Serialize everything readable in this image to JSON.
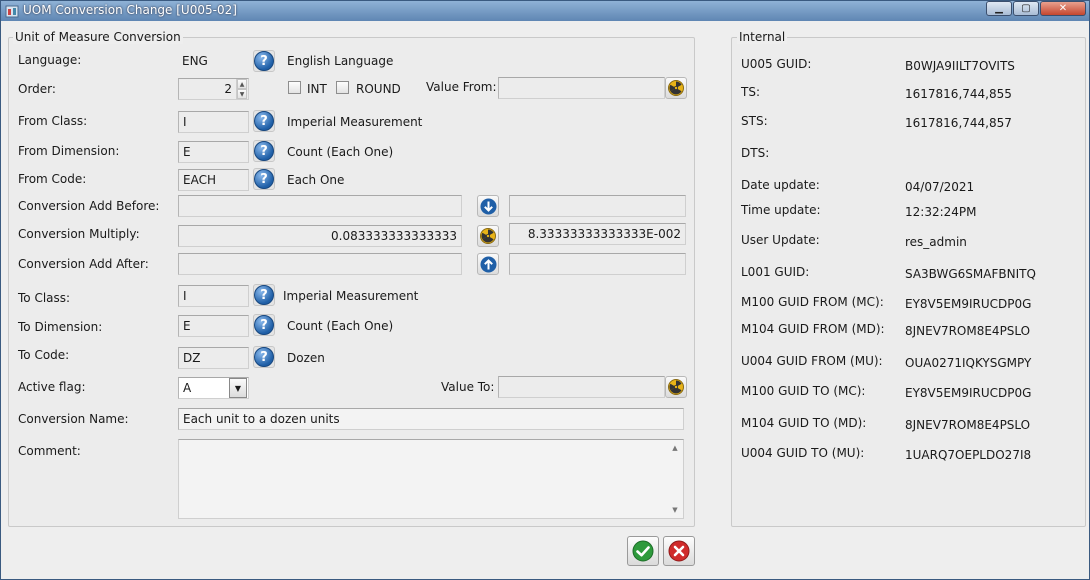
{
  "window": {
    "title": "UOM Conversion Change [U005-02]"
  },
  "left": {
    "section_title": "Unit of Measure Conversion",
    "language": {
      "label": "Language:",
      "value": "ENG",
      "desc": "English Language"
    },
    "order": {
      "label": "Order:",
      "value": "2",
      "int_label": "INT",
      "round_label": "ROUND",
      "value_from_label": "Value From:",
      "value_from": ""
    },
    "from_class": {
      "label": "From Class:",
      "value": "I",
      "desc": "Imperial Measurement"
    },
    "from_dimension": {
      "label": "From Dimension:",
      "value": "E",
      "desc": "Count (Each One)"
    },
    "from_code": {
      "label": "From Code:",
      "value": "EACH",
      "desc": "Each One"
    },
    "add_before": {
      "label": "Conversion Add Before:",
      "value": "",
      "value2": ""
    },
    "multiply": {
      "label": "Conversion Multiply:",
      "value": "0.083333333333333",
      "value2": "8.33333333333333E-002"
    },
    "add_after": {
      "label": "Conversion Add After:",
      "value": "",
      "value2": ""
    },
    "to_class": {
      "label": "To Class:",
      "value": "I",
      "desc": "Imperial Measurement"
    },
    "to_dimension": {
      "label": "To Dimension:",
      "value": "E",
      "desc": "Count (Each One)"
    },
    "to_code": {
      "label": "To Code:",
      "value": "DZ",
      "desc": "Dozen"
    },
    "active_flag": {
      "label": "Active flag:",
      "value": "A",
      "value_to_label": "Value To:",
      "value_to": ""
    },
    "conversion_name": {
      "label": "Conversion Name:",
      "value": "Each unit to a dozen units"
    },
    "comment": {
      "label": "Comment:",
      "value": ""
    }
  },
  "internal": {
    "section_title": "Internal",
    "rows": [
      {
        "label": "U005 GUID:",
        "value": "B0WJA9IILT7OVITS"
      },
      {
        "label": "TS:",
        "value": "1617816,744,855"
      },
      {
        "label": "STS:",
        "value": "1617816,744,857"
      },
      {
        "label": "DTS:",
        "value": ""
      },
      {
        "label": "Date update:",
        "value": "04/07/2021"
      },
      {
        "label": "Time update:",
        "value": "12:32:24PM"
      },
      {
        "label": "User Update:",
        "value": "res_admin"
      },
      {
        "label": "L001 GUID:",
        "value": "SA3BWG6SMAFBNITQ"
      },
      {
        "label": "M100 GUID FROM (MC):",
        "value": "EY8V5EM9IRUCDP0G"
      },
      {
        "label": "M104 GUID FROM (MD):",
        "value": "8JNEV7ROM8E4PSLO"
      },
      {
        "label": "U004 GUID FROM (MU):",
        "value": "OUA0271IQKYSGMPY"
      },
      {
        "label": "M100 GUID TO (MC):",
        "value": "EY8V5EM9IRUCDP0G"
      },
      {
        "label": "M104 GUID TO (MD):",
        "value": "8JNEV7ROM8E4PSLO"
      },
      {
        "label": "U004 GUID TO (MU):",
        "value": "1UARQ7OEPLDO27I8"
      }
    ]
  },
  "icons": {
    "help": "question-mark-icon",
    "radiation": "radiation-icon",
    "arrow_down": "arrow-down-icon",
    "arrow_up": "arrow-up-icon",
    "ok": "checkmark-icon",
    "cancel": "cancel-x-icon"
  },
  "colors": {
    "help_blue": "#1f5fa7",
    "ok_green": "#2e9a3c",
    "cancel_red": "#d02a2a",
    "radiation_yellow": "#e8b318"
  }
}
